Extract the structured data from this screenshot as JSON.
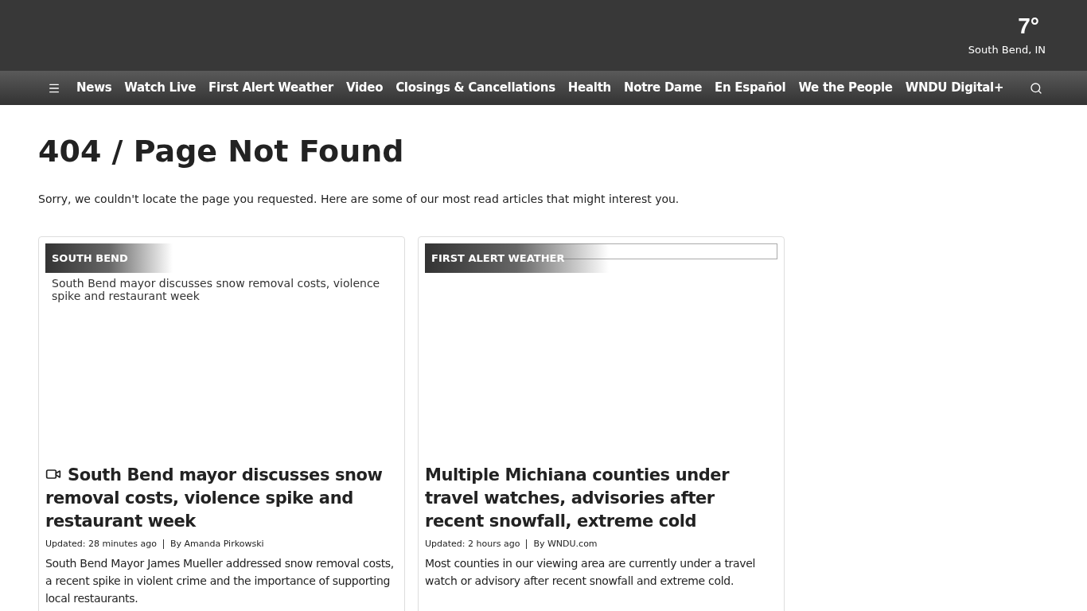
{
  "header": {
    "temperature": "7°",
    "location": "South Bend, IN"
  },
  "nav": {
    "items": [
      {
        "label": "News"
      },
      {
        "label": "Watch Live"
      },
      {
        "label": "First Alert Weather"
      },
      {
        "label": "Video"
      },
      {
        "label": "Closings & Cancellations"
      },
      {
        "label": "Health"
      },
      {
        "label": "Notre Dame"
      },
      {
        "label": "En Español"
      },
      {
        "label": "We the People"
      },
      {
        "label": "WNDU Digital+"
      }
    ]
  },
  "page": {
    "title": "404 / Page Not Found",
    "message": "Sorry, we couldn't locate the page you requested. Here are some of our most read articles that might interest you."
  },
  "articles": [
    {
      "section": "SOUTH BEND",
      "image_alt": "South Bend mayor discusses snow removal costs, violence spike and restaurant week",
      "has_video": true,
      "headline": "South Bend mayor discusses snow removal costs, violence spike and restaurant week",
      "updated": "Updated: 28 minutes ago",
      "byline": "By Amanda Pirkowski",
      "summary": "South Bend Mayor James Mueller addressed snow removal costs, a recent spike in violent crime and the importance of supporting local restaurants."
    },
    {
      "section": "FIRST ALERT WEATHER",
      "has_video": false,
      "headline": "Multiple Michiana counties under travel watches, advisories after recent snowfall, extreme cold",
      "updated": "Updated: 2 hours ago",
      "byline": "By WNDU.com",
      "summary": "Most counties in our viewing area are currently under a travel watch or advisory after recent snowfall and extreme cold."
    }
  ]
}
